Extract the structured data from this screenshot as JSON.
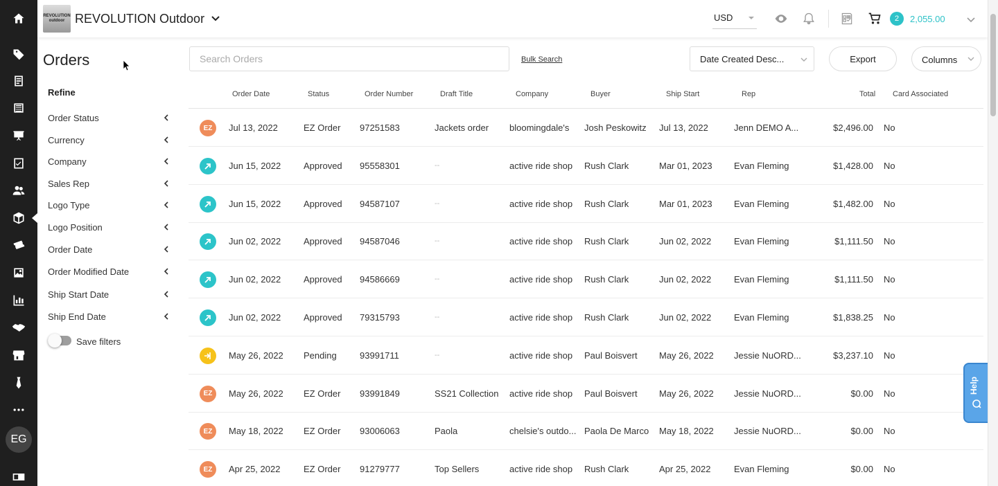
{
  "header": {
    "logo_text": "REVOLUTION outdoor",
    "brand": "REVOLUTION Outdoor",
    "currency": "USD",
    "cart_count": "2",
    "cart_total": "2,055.00"
  },
  "rail": {
    "avatar_initials": "EG",
    "icons": [
      "home-icon",
      "tag-icon",
      "catalog-icon",
      "newspaper-icon",
      "presentation-icon",
      "checklist-icon",
      "users-icon",
      "box-icon",
      "ticket-icon",
      "images-icon",
      "chart-icon",
      "handshake-icon",
      "store-icon",
      "tie-icon",
      "more-icon",
      "card-icon"
    ]
  },
  "page": {
    "title": "Orders",
    "refine_title": "Refine",
    "save_filters_label": "Save filters"
  },
  "filters": [
    "Order Status",
    "Currency",
    "Company",
    "Sales Rep",
    "Logo Type",
    "Logo Position",
    "Order Date",
    "Order Modified Date",
    "Ship Start Date",
    "Ship End Date"
  ],
  "toolbar": {
    "search_placeholder": "Search Orders",
    "bulk_search": "Bulk Search",
    "sort_value": "Date Created Desc...",
    "export_label": "Export",
    "columns_label": "Columns"
  },
  "table": {
    "columns": [
      "Order Date",
      "Status",
      "Order Number",
      "Draft Title",
      "Company",
      "Buyer",
      "Ship Start",
      "Rep",
      "Total",
      "Card Associated"
    ],
    "rows": [
      {
        "badge": "ez",
        "badge_text": "EZ",
        "date": "Jul 13, 2022",
        "status": "EZ Order",
        "number": "97251583",
        "draft": "Jackets order",
        "company": "bloomingdale's",
        "buyer": "Josh Peskowitz",
        "ship": "Jul 13, 2022",
        "rep": "Jenn DEMO A...",
        "total": "$2,496.00",
        "card": "No"
      },
      {
        "badge": "approved",
        "badge_text": "",
        "date": "Jun 15, 2022",
        "status": "Approved",
        "number": "95558301",
        "draft": "--",
        "company": "active ride shop",
        "buyer": "Rush Clark",
        "ship": "Mar 01, 2023",
        "rep": "Evan Fleming",
        "total": "$1,428.00",
        "card": "No"
      },
      {
        "badge": "approved",
        "badge_text": "",
        "date": "Jun 15, 2022",
        "status": "Approved",
        "number": "94587107",
        "draft": "--",
        "company": "active ride shop",
        "buyer": "Rush Clark",
        "ship": "Mar 01, 2023",
        "rep": "Evan Fleming",
        "total": "$1,482.00",
        "card": "No"
      },
      {
        "badge": "approved",
        "badge_text": "",
        "date": "Jun 02, 2022",
        "status": "Approved",
        "number": "94587046",
        "draft": "--",
        "company": "active ride shop",
        "buyer": "Rush Clark",
        "ship": "Jun 02, 2022",
        "rep": "Evan Fleming",
        "total": "$1,111.50",
        "card": "No"
      },
      {
        "badge": "approved",
        "badge_text": "",
        "date": "Jun 02, 2022",
        "status": "Approved",
        "number": "94586669",
        "draft": "--",
        "company": "active ride shop",
        "buyer": "Rush Clark",
        "ship": "Jun 02, 2022",
        "rep": "Evan Fleming",
        "total": "$1,111.50",
        "card": "No"
      },
      {
        "badge": "approved",
        "badge_text": "",
        "date": "Jun 02, 2022",
        "status": "Approved",
        "number": "79315793",
        "draft": "--",
        "company": "active ride shop",
        "buyer": "Rush Clark",
        "ship": "Jun 02, 2022",
        "rep": "Evan Fleming",
        "total": "$1,838.25",
        "card": "No"
      },
      {
        "badge": "pending",
        "badge_text": "",
        "date": "May 26, 2022",
        "status": "Pending",
        "number": "93991711",
        "draft": "--",
        "company": "active ride shop",
        "buyer": "Paul Boisvert",
        "ship": "May 26, 2022",
        "rep": "Jessie NuORD...",
        "total": "$3,237.10",
        "card": "No"
      },
      {
        "badge": "ez",
        "badge_text": "EZ",
        "date": "May 26, 2022",
        "status": "EZ Order",
        "number": "93991849",
        "draft": "SS21 Collection",
        "company": "active ride shop",
        "buyer": "Paul Boisvert",
        "ship": "May 26, 2022",
        "rep": "Jessie NuORD...",
        "total": "$0.00",
        "card": "No"
      },
      {
        "badge": "ez",
        "badge_text": "EZ",
        "date": "May 18, 2022",
        "status": "EZ Order",
        "number": "93006063",
        "draft": "Paola",
        "company": "chelsie's outdo...",
        "buyer": "Paola De Marco",
        "ship": "May 18, 2022",
        "rep": "Jessie NuORD...",
        "total": "$0.00",
        "card": "No"
      },
      {
        "badge": "ez",
        "badge_text": "EZ",
        "date": "Apr 25, 2022",
        "status": "EZ Order",
        "number": "91279777",
        "draft": "Top Sellers",
        "company": "active ride shop",
        "buyer": "Rush Clark",
        "ship": "Apr 25, 2022",
        "rep": "Evan Fleming",
        "total": "$0.00",
        "card": "No"
      }
    ]
  },
  "help": {
    "label": "Help"
  },
  "colors": {
    "accent": "#2dc2c8",
    "ez": "#ef8c5a",
    "pending": "#f6c21a",
    "help": "#5aa5e8",
    "rail": "#1f1f1f"
  }
}
